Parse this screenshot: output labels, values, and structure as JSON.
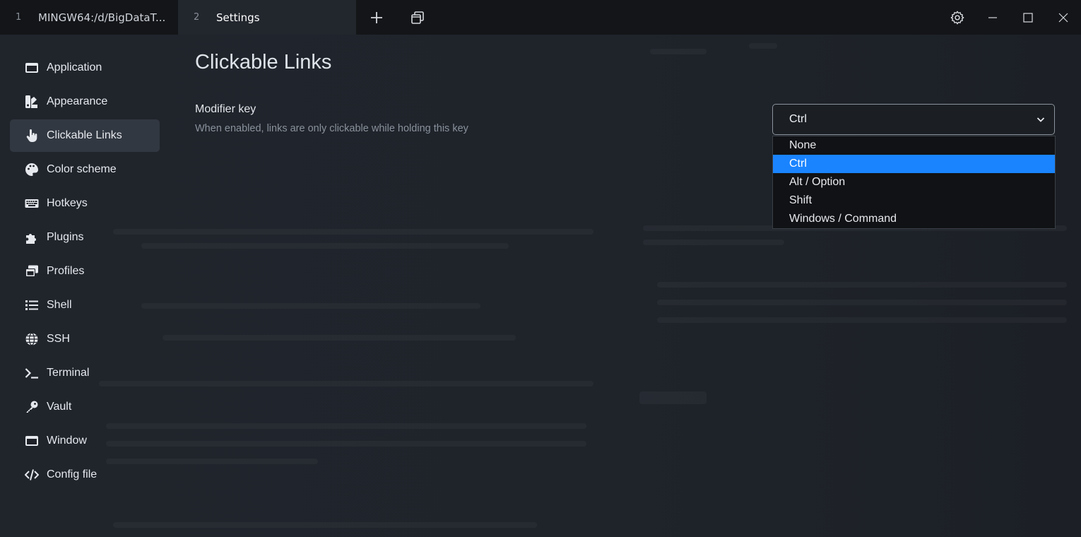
{
  "tabs": [
    {
      "number": "1",
      "title": "MINGW64:/d/BigDataT..."
    },
    {
      "number": "2",
      "title": "Settings"
    }
  ],
  "titlebar": {
    "new_tab_icon": "plus-icon",
    "duplicate_icon": "windows-icon",
    "settings_icon": "gear-icon",
    "minimize_icon": "minimize-icon",
    "maximize_icon": "maximize-icon",
    "close_icon": "close-icon"
  },
  "sidebar": {
    "items": [
      {
        "label": "Application",
        "icon": "window-icon"
      },
      {
        "label": "Appearance",
        "icon": "swatchbook-icon"
      },
      {
        "label": "Clickable Links",
        "icon": "hand-pointer-icon",
        "active": true
      },
      {
        "label": "Color scheme",
        "icon": "palette-icon"
      },
      {
        "label": "Hotkeys",
        "icon": "keyboard-icon"
      },
      {
        "label": "Plugins",
        "icon": "puzzle-icon"
      },
      {
        "label": "Profiles",
        "icon": "window-stack-icon"
      },
      {
        "label": "Shell",
        "icon": "list-icon"
      },
      {
        "label": "SSH",
        "icon": "globe-icon"
      },
      {
        "label": "Terminal",
        "icon": "terminal-icon"
      },
      {
        "label": "Vault",
        "icon": "key-icon"
      },
      {
        "label": "Window",
        "icon": "window-icon"
      },
      {
        "label": "Config file",
        "icon": "code-icon"
      }
    ]
  },
  "main": {
    "title": "Clickable Links",
    "modifier": {
      "label": "Modifier key",
      "description": "When enabled, links are only clickable while holding this key",
      "value": "Ctrl",
      "options": [
        "None",
        "Ctrl",
        "Alt / Option",
        "Shift",
        "Windows / Command"
      ],
      "selected_index": 1
    }
  },
  "colors": {
    "accent": "#1a84ff",
    "background": "#1e2228",
    "titlebar": "#131518"
  }
}
